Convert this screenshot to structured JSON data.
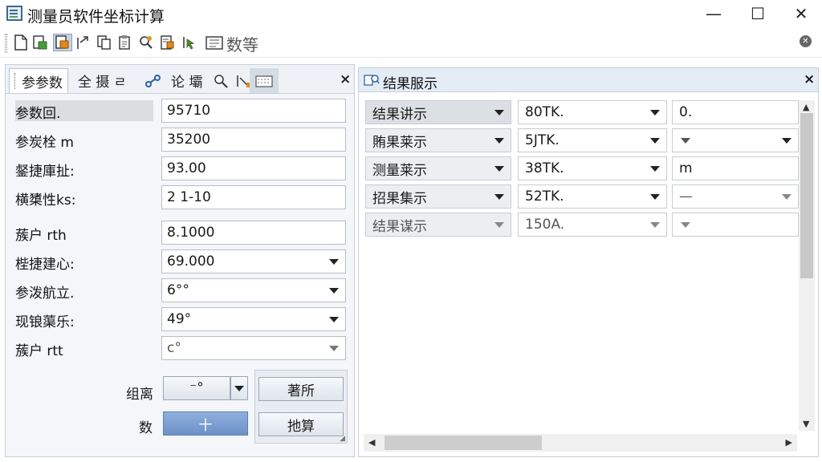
{
  "window": {
    "title": "测量员软件坐标计算",
    "minimize": "—",
    "maximize": "☐",
    "close": "✕"
  },
  "toolbar": {
    "text": "数等"
  },
  "left_panel": {
    "tabs": [
      {
        "label": "参参数"
      },
      {
        "label": "全 摄 ㄹ"
      },
      {
        "label": "论 壩"
      }
    ],
    "close": "×",
    "fields": [
      {
        "label": "参数回.",
        "value": "95710",
        "dropdown": false
      },
      {
        "label": "参炭栓 m",
        "value": "35200",
        "dropdown": false
      },
      {
        "label": "錖捷庫扯:",
        "value": "93.00",
        "dropdown": false
      },
      {
        "label": "横橥性ks:",
        "value": "2 1-10",
        "dropdown": false
      },
      {
        "label": "蔟户 rth",
        "value": "8.1000",
        "dropdown": false
      },
      {
        "label": "梐捷建⼼:",
        "value": "69.000",
        "dropdown": true
      },
      {
        "label": "参泼航立.",
        "value": "6°°",
        "dropdown": true
      },
      {
        "label": "现锒蕖乐:",
        "value": "49°",
        "dropdown": true
      },
      {
        "label": "蔟户 rtt",
        "value": "c°",
        "dropdown": true
      }
    ],
    "controls": {
      "combo_label": "组离",
      "combo_value": "⁻°",
      "num_label": "数",
      "num_button": "十",
      "btn1": "著所",
      "btn2": "扡算"
    }
  },
  "right_panel": {
    "title": "结果服示",
    "close": "×",
    "rows": [
      {
        "c1": "结果讲示",
        "c2": "80TK.",
        "c3": "0."
      },
      {
        "c1": "賄果莱示",
        "c2": "5JTK.",
        "c3": ""
      },
      {
        "c1": "测量莱示",
        "c2": "38TK.",
        "c3": "m"
      },
      {
        "c1": "招果集示",
        "c2": "52TK.",
        "c3": "—"
      },
      {
        "c1": "结果谋示",
        "c2": "150A.",
        "c3": ""
      }
    ]
  }
}
